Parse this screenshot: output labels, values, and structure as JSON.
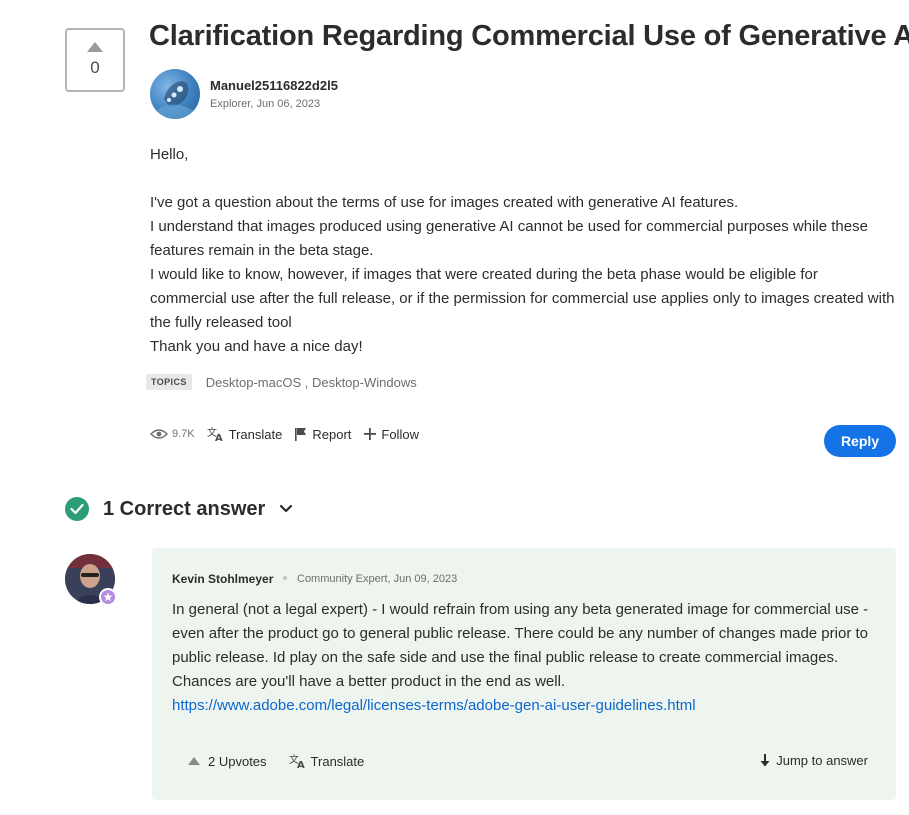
{
  "question": {
    "votes": "0",
    "title": "Clarification Regarding Commercial Use of Generative AI",
    "author": {
      "name": "Manuel25116822d2l5",
      "meta": "Explorer, Jun 06, 2023"
    },
    "body": {
      "greeting": "Hello,",
      "line1": "I've got a question about the terms of use for images created with generative AI features.",
      "line2": "I understand that images produced using generative AI cannot be used for commercial purposes while these features remain in the beta stage.",
      "line3": "I would like to know, however, if images that were created during the beta phase would be eligible for commercial use after the full release, or if the permission for commercial use applies only to images created with the fully released tool",
      "line4": "Thank you and have a nice day!"
    },
    "topics": {
      "label": "TOPICS",
      "list": "Desktop-macOS , Desktop-Windows"
    },
    "actions": {
      "views": "9.7K",
      "translate": "Translate",
      "report": "Report",
      "follow": "Follow",
      "reply": "Reply"
    }
  },
  "correct_answer": {
    "header": "1 Correct answer",
    "author": {
      "name": "Kevin Stohlmeyer",
      "meta": "Community Expert, Jun 09, 2023"
    },
    "body": "In general (not a legal expert) - I would refrain from using any beta generated image for commercial use - even after the product go to general public release. There could be any number of changes made prior to public release. Id play on the safe side and use the final public release to create commercial images. Chances are you'll have a better product in the end as well.",
    "link": "https://www.adobe.com/legal/licenses-terms/adobe-gen-ai-user-guidelines.html",
    "upvotes": "2 Upvotes",
    "translate": "Translate",
    "jump": "Jump to answer"
  },
  "colors": {
    "accent": "#1473e6",
    "correct_green": "#2d9d78",
    "card_bg": "#eef5ee",
    "link": "#0d66d0"
  }
}
